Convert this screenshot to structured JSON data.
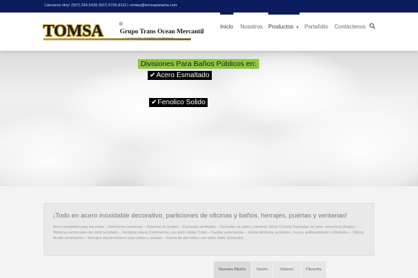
{
  "topbar": {
    "text": "Llámanos Hoy! (507) 264-5439 (507) 6706-8112  |  ventas@tomsapanama.com"
  },
  "logo": {
    "word": "TOMSA",
    "reg": "®",
    "company": "Grupo Trans Ocean Mercantil",
    "tagline": "Construcción • Acabados • Suministros."
  },
  "nav": {
    "items": [
      {
        "label": "Inicio"
      },
      {
        "label": "Nosotros"
      },
      {
        "label": "Productos"
      },
      {
        "label": "Portafolio"
      },
      {
        "label": "Contáctenos"
      }
    ],
    "search_icon": "search-icon",
    "dropdown_icon": "chevron-down-icon",
    "accent": "#0b1d5e"
  },
  "hero": {
    "title": "Divisiones Para Baños Públicos en:",
    "check": "✔",
    "options": [
      "Acero Esmaltado",
      "Fenolico Solido"
    ],
    "title_bg": "#8cc63f"
  },
  "section": {
    "heading": "¡Todo en acero inoxidable decorativo, particiones de oficinas y baños, herrajes, puertas y ventanas!",
    "body": "Acero inoxidable para barandas – Particiones sanitarias – Sistemas de lockers – Fachadas ventiladas – Fachadas de vidrio y aluminio (Muro Cortina) Fachadas de vidrio estructural (Araña) – Vidrieras comerciales de vidrio templado – Ventanas Heavy Commercial, con vidrio doble/ Triple – Puertas automáticas – Vidrios térmicos, acústicos, curvos, antibandalismo y blindados – Vidrios de alto rendimiento – Herrajes arquitectónicos para vidrios y puertas – Puerta de alto tráfico con vidrio doble (Insulado)."
  },
  "tabs": [
    {
      "label": "Nuestra Misión"
    },
    {
      "label": "Visión"
    },
    {
      "label": "Valores"
    },
    {
      "label": "Filosofía"
    }
  ]
}
